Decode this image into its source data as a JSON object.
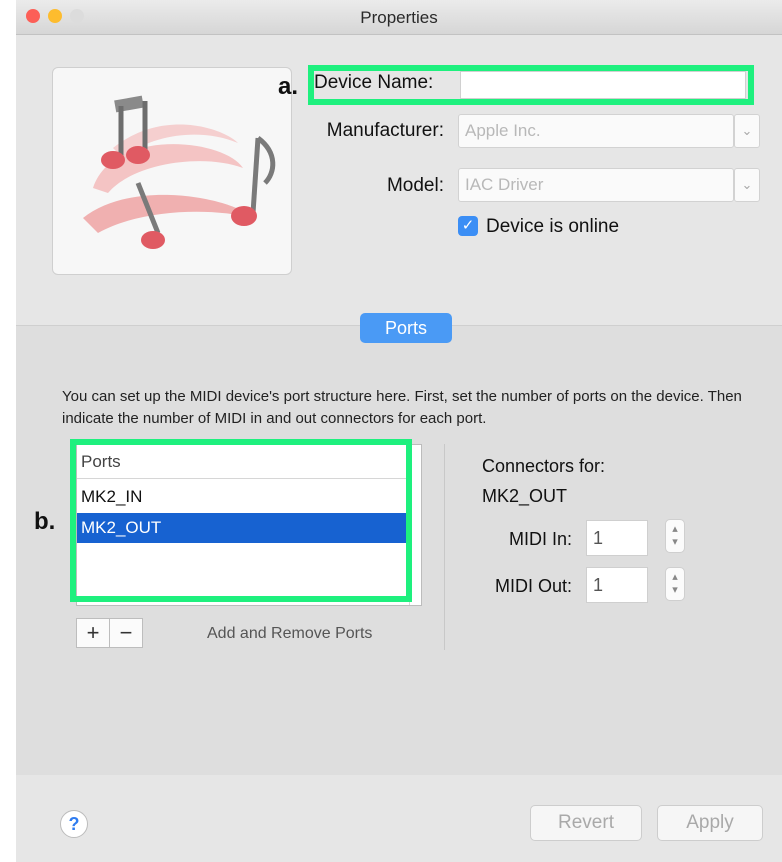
{
  "window": {
    "title": "Properties"
  },
  "traffic_lights": {
    "close_color": "#fc5f57",
    "minimize_color": "#fdbc2e",
    "zoom_color": "#dcdcdc"
  },
  "highlight_color": "#1ef07e",
  "markers": {
    "a": "a.",
    "b": "b."
  },
  "device": {
    "name_label": "Device Name:",
    "name_value": "",
    "manufacturer_label": "Manufacturer:",
    "manufacturer_value": "Apple Inc.",
    "model_label": "Model:",
    "model_value": "IAC Driver",
    "online_label": "Device is online",
    "online_checked": true
  },
  "ports_tab": {
    "label": "Ports"
  },
  "description": "You can set up the MIDI device's port structure here. First, set the number of ports on the device. Then indicate the number of MIDI in and out connectors for each port.",
  "ports_table": {
    "header": "Ports",
    "rows": [
      "MK2_IN",
      "MK2_OUT"
    ],
    "selected_index": 1
  },
  "port_buttons": {
    "add": "+",
    "remove": "−",
    "caption": "Add and Remove Ports"
  },
  "connectors": {
    "title": "Connectors for:",
    "port": "MK2_OUT",
    "midi_in_label": "MIDI In:",
    "midi_in_value": "1",
    "midi_out_label": "MIDI Out:",
    "midi_out_value": "1"
  },
  "footer": {
    "help": "?",
    "revert": "Revert",
    "apply": "Apply"
  },
  "icons": {
    "device_icon": "midi-notes-icon",
    "dropdown": "chevron-down-icon",
    "stepper": "stepper-arrows-icon",
    "check": "checkmark-icon"
  }
}
